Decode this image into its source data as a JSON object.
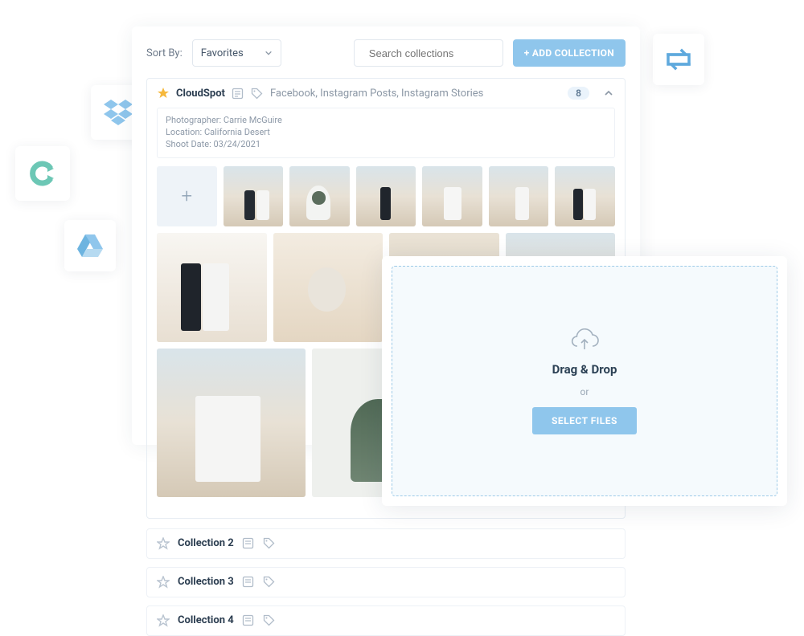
{
  "toolbar": {
    "sort_label": "Sort By:",
    "sort_value": "Favorites",
    "search_placeholder": "Search collections",
    "add_button": "+ ADD COLLECTION"
  },
  "collection": {
    "name": "CloudSpot",
    "tags": "Facebook, Instagram Posts, Instagram Stories",
    "count": "8",
    "meta": {
      "photographer_label": "Photographer:",
      "photographer_value": "Carrie McGuire",
      "location_label": "Location:",
      "location_value": "California Desert",
      "date_label": "Shoot Date:",
      "date_value": "03/24/2021"
    }
  },
  "rows": [
    {
      "name": "Collection 2"
    },
    {
      "name": "Collection 3"
    },
    {
      "name": "Collection 4"
    }
  ],
  "dropzone": {
    "title": "Drag & Drop",
    "or": "or",
    "button": "SELECT FILES"
  },
  "integrations": {
    "dropbox": "dropbox-icon",
    "clogo": "c-logo-icon",
    "drive": "google-drive-icon",
    "reshare": "reshare-icon"
  }
}
